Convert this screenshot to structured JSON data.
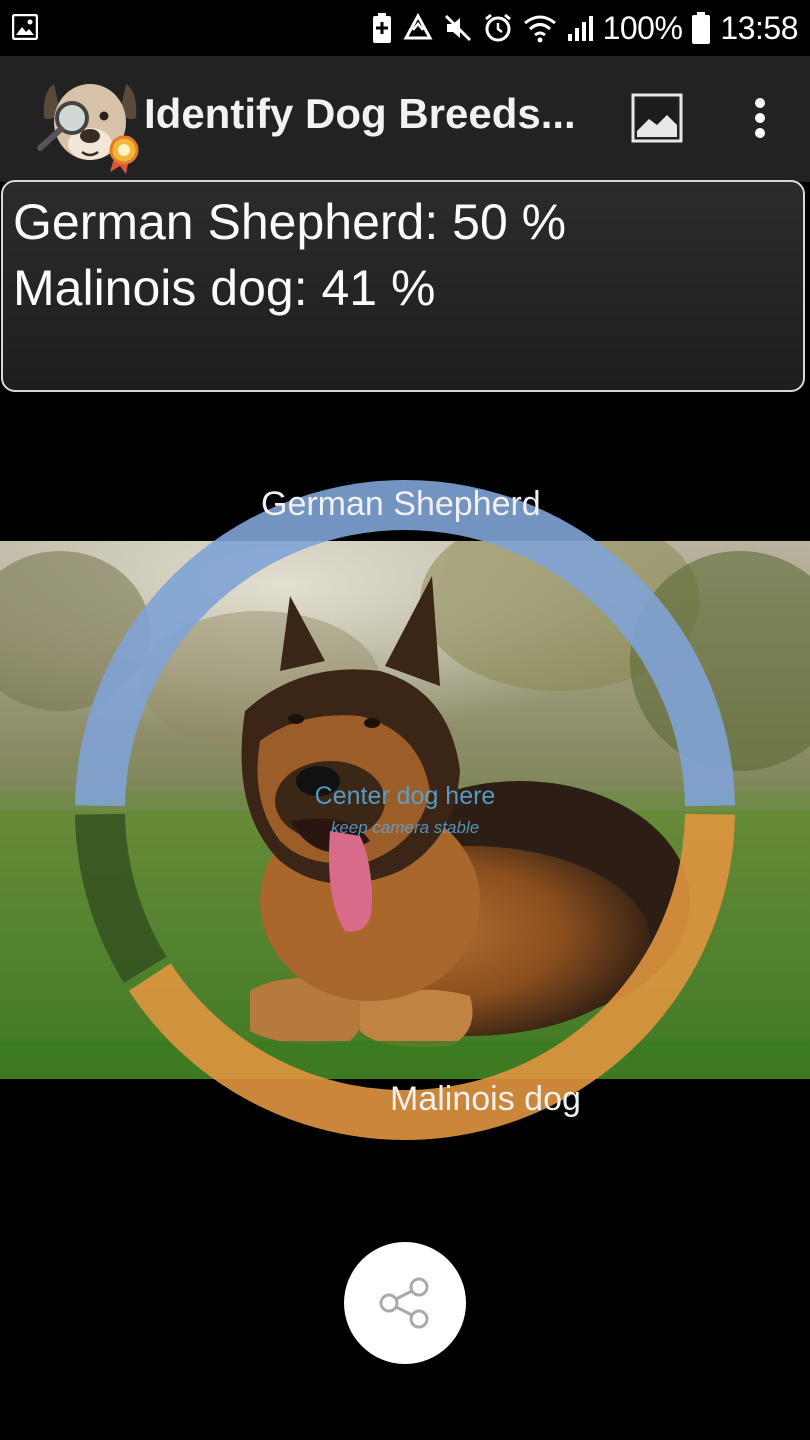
{
  "status_bar": {
    "battery_percent": "100%",
    "time": "13:58"
  },
  "toolbar": {
    "title": "Identify Dog Breeds...",
    "logo_icon": "dog-detective-icon",
    "gallery_icon": "image-gallery-icon",
    "overflow_icon": "more-vert-icon"
  },
  "results": {
    "lines": [
      "German Shepherd: 50 %",
      "Malinois dog: 41 %"
    ],
    "breeds": [
      {
        "name": "German Shepherd",
        "percent": 50,
        "color": "#7fa3d6"
      },
      {
        "name": "Malinois dog",
        "percent": 41,
        "color": "#e0953f"
      }
    ],
    "other_percent": 9
  },
  "ring": {
    "top_label": "German Shepherd",
    "bottom_label": "Malinois dog",
    "hint_main": "Center dog here",
    "hint_sub": "keep camera stable"
  },
  "share": {
    "icon": "share-icon"
  }
}
